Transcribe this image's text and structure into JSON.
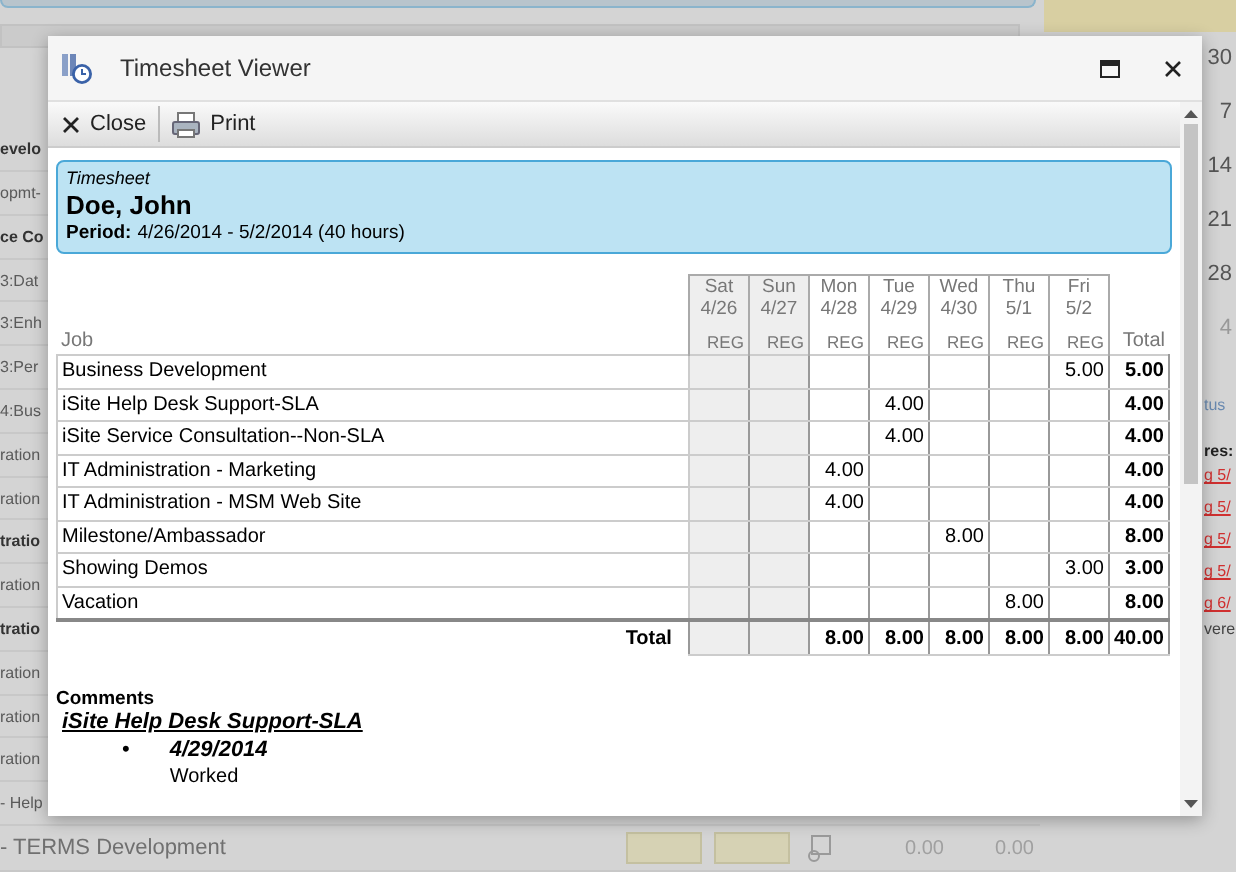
{
  "background": {
    "left_rows": [
      {
        "text": "evelo",
        "bold": true
      },
      {
        "text": "opmt-",
        "bold": false
      },
      {
        "text": "ce Co",
        "bold": true
      },
      {
        "text": "3:Dat",
        "bold": false
      },
      {
        "text": "3:Enh",
        "bold": false
      },
      {
        "text": "3:Per",
        "bold": false
      },
      {
        "text": "4:Bus",
        "bold": false
      },
      {
        "text": "ration",
        "bold": false
      },
      {
        "text": "ration",
        "bold": false
      },
      {
        "text": "tratio",
        "bold": true
      },
      {
        "text": "ration",
        "bold": false
      },
      {
        "text": "tratio",
        "bold": true
      },
      {
        "text": "ration",
        "bold": false
      },
      {
        "text": "ration",
        "bold": false
      },
      {
        "text": "ration",
        "bold": false
      },
      {
        "text": "- Help",
        "bold": false
      }
    ],
    "bottom_row": {
      "label": "- TERMS Development",
      "values": [
        "0.00",
        "0.00"
      ]
    },
    "calendar_days": [
      "30",
      "7",
      "14",
      "21",
      "28",
      "4"
    ],
    "side_labels": [
      "tus",
      "res:"
    ],
    "side_links": [
      "g 5/",
      "g 5/",
      "g 5/",
      "g 5/",
      "g 6/"
    ],
    "side_note": "vere"
  },
  "window": {
    "title": "Timesheet Viewer"
  },
  "toolbar": [
    {
      "label": "Close",
      "kind": "close"
    },
    {
      "label": "Print",
      "kind": "print"
    }
  ],
  "header": {
    "caption": "Timesheet",
    "name": "Doe, John",
    "period_label": "Period:",
    "period": "4/26/2014 - 5/2/2014 (40 hours)"
  },
  "table": {
    "job_heading": "Job",
    "total_heading": "Total",
    "days": [
      {
        "day": "Sat",
        "date": "4/26",
        "type": "REG",
        "weekend": true
      },
      {
        "day": "Sun",
        "date": "4/27",
        "type": "REG",
        "weekend": true
      },
      {
        "day": "Mon",
        "date": "4/28",
        "type": "REG",
        "weekend": false
      },
      {
        "day": "Tue",
        "date": "4/29",
        "type": "REG",
        "weekend": false
      },
      {
        "day": "Wed",
        "date": "4/30",
        "type": "REG",
        "weekend": false
      },
      {
        "day": "Thu",
        "date": "5/1",
        "type": "REG",
        "weekend": false
      },
      {
        "day": "Fri",
        "date": "5/2",
        "type": "REG",
        "weekend": false
      }
    ],
    "rows": [
      {
        "job": "Business Development",
        "cells": [
          {},
          {},
          {},
          {},
          {},
          {},
          {
            "hours": "5.00"
          }
        ],
        "total": "5.00"
      },
      {
        "job": "iSite Help Desk Support-SLA",
        "cells": [
          {},
          {},
          {},
          {
            "hours": "4.00"
          },
          {},
          {},
          {}
        ],
        "total": "4.00"
      },
      {
        "job": "iSite Service Consultation--Non-SLA",
        "cells": [
          {},
          {},
          {},
          {
            "hours": "4.00"
          },
          {},
          {},
          {}
        ],
        "total": "4.00"
      },
      {
        "job": "IT Administration - Marketing",
        "cells": [
          {},
          {},
          {
            "hours": "4.00"
          },
          {},
          {},
          {},
          {}
        ],
        "total": "4.00"
      },
      {
        "job": "IT Administration - MSM Web Site",
        "cells": [
          {},
          {},
          {
            "hours": "4.00"
          },
          {},
          {},
          {},
          {}
        ],
        "total": "4.00"
      },
      {
        "job": "Milestone/Ambassador",
        "cells": [
          {},
          {},
          {},
          {},
          {
            "hours": "8.00"
          },
          {},
          {}
        ],
        "total": "8.00"
      },
      {
        "job": "Showing Demos",
        "cells": [
          {},
          {},
          {},
          {},
          {},
          {},
          {
            "hours": "3.00"
          }
        ],
        "total": "3.00"
      },
      {
        "job": "Vacation",
        "cells": [
          {},
          {},
          {},
          {},
          {},
          {
            "hours": "8.00"
          },
          {}
        ],
        "total": "8.00"
      }
    ],
    "total_row": {
      "label": "Total",
      "cells": [
        {},
        {},
        {
          "hours": "8.00"
        },
        {
          "hours": "8.00"
        },
        {
          "hours": "8.00"
        },
        {
          "hours": "8.00"
        },
        {
          "hours": "8.00"
        }
      ],
      "total": "40.00"
    }
  },
  "comments": {
    "heading": "Comments",
    "groups": [
      {
        "job": "iSite Help Desk Support-SLA",
        "entries": [
          {
            "bullet": "•",
            "date": "4/29/2014",
            "text": "Worked"
          }
        ]
      }
    ]
  }
}
